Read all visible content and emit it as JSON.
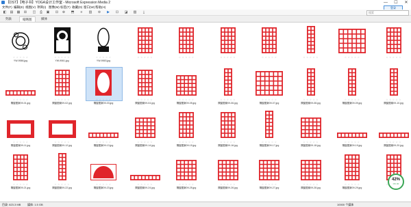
{
  "window": {
    "title": "【DST】【电子书】YOGA设计工作室 - Microsoft Expression Media 2",
    "controls": [
      "—",
      "☐",
      "✕"
    ]
  },
  "menu": {
    "items": [
      "文件(F)",
      "编辑(E)",
      "视图(V)",
      "项目(I)",
      "图像(M)",
      "标签(T)",
      "收藏(D)",
      "窗口(W)",
      "帮助(H)"
    ],
    "sign_in": "登录"
  },
  "toolbar": {
    "buttons": [
      "◧",
      "▤",
      "▦",
      "⊞",
      "◫",
      "⎙",
      "▣",
      "⊟",
      "⊕",
      "⬒",
      "≡",
      "▥",
      "⊚",
      "▶",
      "⊡",
      "◪",
      "▨",
      "⤓"
    ],
    "search_placeholder": "搜索"
  },
  "tabs": [
    "列表",
    "缩略图",
    "媒体"
  ],
  "active_tab": 1,
  "grid": {
    "items": [
      {
        "name": "YW-9066.jpg",
        "stars": "☆ ☆ ☆ ☆ ☆",
        "kind": "black-circles"
      },
      {
        "name": "YW-9061.jpg",
        "stars": "☆ ☆ ☆ ☆ ☆",
        "kind": "black-lattice"
      },
      {
        "name": "YW-9063.jpg",
        "stars": "☆ ☆ ☆ ☆ ☆",
        "kind": "black-oval"
      },
      {
        "name": "",
        "stars": "☆ ☆ ☆ ☆ ☆",
        "kind": "red-panel"
      },
      {
        "name": "",
        "stars": "☆ ☆ ☆ ☆ ☆",
        "kind": "red-panel"
      },
      {
        "name": "",
        "stars": "☆ ☆ ☆ ☆ ☆",
        "kind": "red-panel"
      },
      {
        "name": "",
        "stars": "☆ ☆ ☆ ☆ ☆",
        "kind": "red-panel"
      },
      {
        "name": "",
        "stars": "☆ ☆ ☆ ☆ ☆",
        "kind": "red-narrow"
      },
      {
        "name": "",
        "stars": "☆ ☆ ☆ ☆ ☆",
        "kind": "red-wide"
      },
      {
        "name": "",
        "stars": "☆ ☆ ☆ ☆ ☆",
        "kind": "red-panel"
      },
      {
        "name": "隔窗图案09-01.jpg",
        "stars": "☆ ☆ ☆ ☆ ☆",
        "kind": "red-strip"
      },
      {
        "name": "隔窗图案09-02.jpg",
        "stars": "☆ ☆ ☆ ☆ ☆",
        "kind": "red-panel"
      },
      {
        "name": "隔窗图案09-03.jpg",
        "stars": "☆ ☆ ☆ ☆ ☆",
        "kind": "red-oval"
      },
      {
        "name": "隔窗图案09-04.jpg",
        "stars": "☆ ☆ ☆ ☆ ☆",
        "kind": "red-panel"
      },
      {
        "name": "隔窗图案09-05.jpg",
        "stars": "☆ ☆ ☆ ☆ ☆",
        "kind": "red-square"
      },
      {
        "name": "隔窗图案09-06.jpg",
        "stars": "☆ ☆ ☆ ☆ ☆",
        "kind": "red-narrow"
      },
      {
        "name": "隔窗图案09-07.jpg",
        "stars": "☆ ☆ ☆ ☆ ☆",
        "kind": "red-wide"
      },
      {
        "name": "隔窗图案09-08.jpg",
        "stars": "☆ ☆ ☆ ☆ ☆",
        "kind": "red-narrow"
      },
      {
        "name": "隔窗图案09-09.jpg",
        "stars": "☆ ☆ ☆ ☆ ☆",
        "kind": "red-narrow"
      },
      {
        "name": "隔窗图案09-10.jpg",
        "stars": "☆ ☆ ☆ ☆ ☆",
        "kind": "red-narrow"
      },
      {
        "name": "隔窗图案09-11.jpg",
        "stars": "☆ ☆ ☆ ☆ ☆",
        "kind": "red-frame"
      },
      {
        "name": "隔窗图案09-12.jpg",
        "stars": "☆ ☆ ☆ ☆ ☆",
        "kind": "red-frame"
      },
      {
        "name": "隔窗图案09-13.jpg",
        "stars": "☆ ☆ ☆ ☆ ☆",
        "kind": "red-strip"
      },
      {
        "name": "隔窗图案09-14.jpg",
        "stars": "☆ ☆ ☆ ☆ ☆",
        "kind": "red-square"
      },
      {
        "name": "隔窗图案09-15.jpg",
        "stars": "☆ ☆ ☆ ☆ ☆",
        "kind": "red-panel"
      },
      {
        "name": "隔窗图案09-16.jpg",
        "stars": "☆ ☆ ☆ ☆ ☆",
        "kind": "red-panel"
      },
      {
        "name": "隔窗图案09-17.jpg",
        "stars": "☆ ☆ ☆ ☆ ☆",
        "kind": "red-narrow"
      },
      {
        "name": "隔窗图案09-18.jpg",
        "stars": "☆ ☆ ☆ ☆ ☆",
        "kind": "red-square"
      },
      {
        "name": "隔窗图案09-19.jpg",
        "stars": "☆ ☆ ☆ ☆ ☆",
        "kind": "red-strip"
      },
      {
        "name": "隔窗图案09-20.jpg",
        "stars": "☆ ☆ ☆ ☆ ☆",
        "kind": "red-strip"
      },
      {
        "name": "隔窗图案09-21.jpg",
        "stars": "☆ ☆ ☆ ☆ ☆",
        "kind": "red-panel"
      },
      {
        "name": "隔窗图案09-22.jpg",
        "stars": "☆ ☆ ☆ ☆ ☆",
        "kind": "red-narrow"
      },
      {
        "name": "隔窗图案09-23.jpg",
        "stars": "☆ ☆ ☆ ☆ ☆",
        "kind": "red-fan"
      },
      {
        "name": "隔窗图案09-24.jpg",
        "stars": "☆ ☆ ☆ ☆ ☆",
        "kind": "red-strip"
      },
      {
        "name": "隔窗图案09-25.jpg",
        "stars": "☆ ☆ ☆ ☆ ☆",
        "kind": "red-square"
      },
      {
        "name": "隔窗图案09-26.jpg",
        "stars": "☆ ☆ ☆ ☆ ☆",
        "kind": "red-square"
      },
      {
        "name": "隔窗图案09-27.jpg",
        "stars": "☆ ☆ ☆ ☆ ☆",
        "kind": "red-square"
      },
      {
        "name": "隔窗图案09-28.jpg",
        "stars": "☆ ☆ ☆ ☆ ☆",
        "kind": "red-square"
      },
      {
        "name": "隔窗图案09-29.jpg",
        "stars": "☆ ☆ ☆ ☆ ☆",
        "kind": "red-panel"
      },
      {
        "name": "",
        "stars": "☆ ☆ ☆ ☆ ☆",
        "kind": "red-panel"
      }
    ]
  },
  "status": {
    "left": "目录: 823.3 MB",
    "middle": "媒体: 1.5 GB",
    "right": "1/8000 已选择 / 0 已选择",
    "count": "10000 个媒体"
  },
  "zoom": {
    "percent": "42%",
    "label": "OK·00"
  },
  "colors": {
    "accent": "#2e7bd1",
    "pattern_red": "#e0252b",
    "progress_green": "#3aa655"
  }
}
